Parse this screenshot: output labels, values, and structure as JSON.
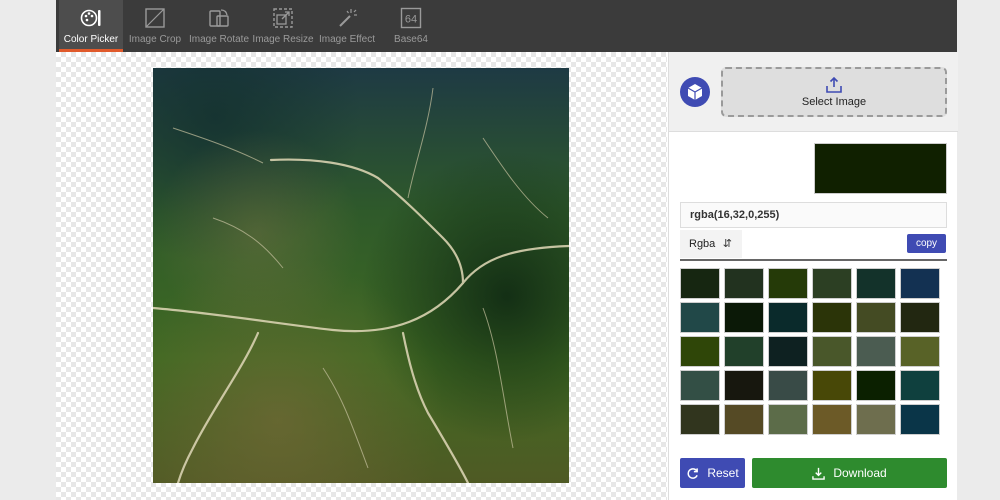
{
  "toolbar": {
    "tools": [
      {
        "label": "Color Picker",
        "icon": "palette-icon"
      },
      {
        "label": "Image Crop",
        "icon": "crop-icon"
      },
      {
        "label": "Image Rotate",
        "icon": "rotate-icon"
      },
      {
        "label": "Image Resize",
        "icon": "resize-icon"
      },
      {
        "label": "Image Effect",
        "icon": "magic-wand-icon"
      },
      {
        "label": "Base64",
        "icon": "base64-icon"
      }
    ],
    "active": "Color Picker",
    "base64_glyph": "64",
    "accent": "#e05a2b"
  },
  "upload": {
    "label": "Select Image",
    "icon": "upload-icon"
  },
  "picked": {
    "color": "#102000",
    "value": "rgba(16,32,0,255)",
    "format": "Rgba",
    "copy_label": "copy"
  },
  "palette": [
    "#162611",
    "#22321f",
    "#253a08",
    "#2c3f23",
    "#13322a",
    "#133152",
    "#214848",
    "#0b1907",
    "#0a2a2b",
    "#2b3408",
    "#444b23",
    "#222711",
    "#2f4608",
    "#21402a",
    "#0e2121",
    "#49572a",
    "#4b5c51",
    "#586227",
    "#334f45",
    "#17170e",
    "#394b47",
    "#484807",
    "#0b2000",
    "#0f403e",
    "#31351e",
    "#554a25",
    "#5c6c49",
    "#6c5a27",
    "#6e6e4e",
    "#0a3548"
  ],
  "actions": {
    "reset_label": "Reset",
    "download_label": "Download",
    "reset_color": "#3f4bb3",
    "download_color": "#2e8b2e"
  }
}
